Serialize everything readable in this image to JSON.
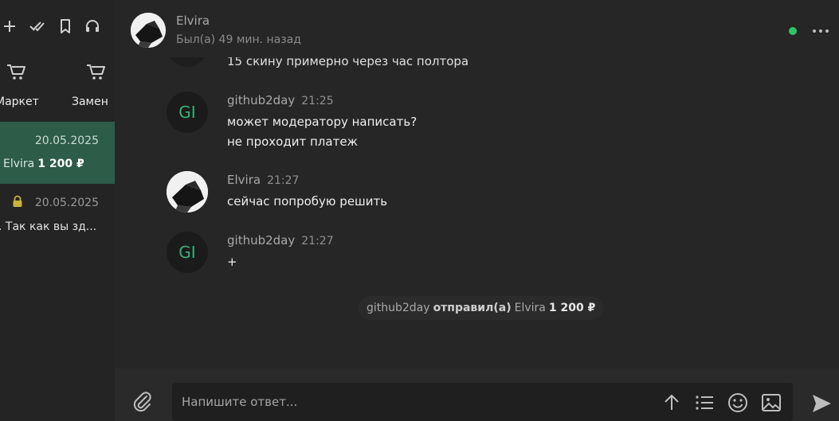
{
  "sidebar": {
    "categories": [
      {
        "label": "Маркет",
        "icon": "cart-icon"
      },
      {
        "label": "Замен",
        "icon": "cart-icon"
      }
    ],
    "deals": [
      {
        "date": "20.05.2025",
        "name": "Elvira",
        "amount": "1 200 ₽",
        "active": true
      },
      {
        "date": "20.05.2025",
        "preview": ". Так как вы зд...",
        "locked": true
      }
    ]
  },
  "header": {
    "name": "Elvira",
    "status": "Был(а) 49 мин. назад",
    "online_color": "#2fc463"
  },
  "messages": {
    "partial_text": "15 скину примерно через час полтора",
    "items": [
      {
        "author": "github2day",
        "time": "21:25",
        "avatar": "GI",
        "lines": [
          "может модератору написать?",
          "не проходит платеж"
        ]
      },
      {
        "author": "Elvira",
        "time": "21:27",
        "avatar": "photo",
        "lines": [
          "сейчас попробую решить"
        ]
      },
      {
        "author": "github2day",
        "time": "21:27",
        "avatar": "GI",
        "lines": [
          "+"
        ]
      }
    ],
    "system": {
      "actor": "github2day",
      "action": "отправил(а)",
      "target": "Elvira",
      "amount": "1 200 ₽"
    }
  },
  "composer": {
    "placeholder": "Напишите ответ..."
  },
  "colors": {
    "accent_green": "#2d5c49",
    "avatar_initials": "#39b178",
    "background": "#262626"
  }
}
